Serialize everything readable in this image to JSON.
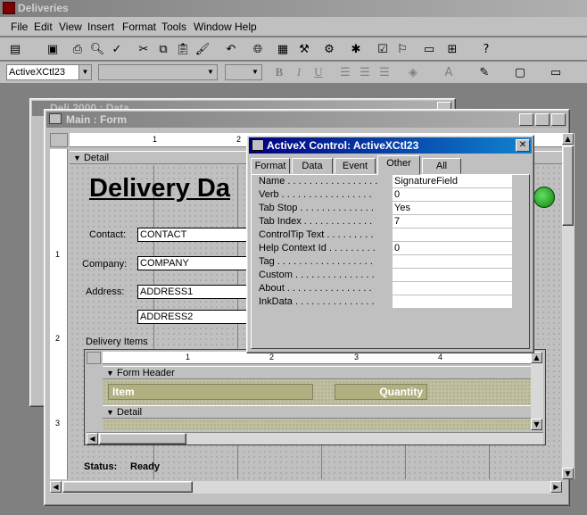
{
  "app": {
    "title": "Deliveries"
  },
  "menu": [
    "File",
    "Edit",
    "View",
    "Insert",
    "Format",
    "Tools",
    "Window",
    "Help"
  ],
  "format_bar": {
    "control_name": "ActiveXCtl23",
    "bold": "B",
    "italic": "I",
    "underline": "U"
  },
  "bg_window": {
    "title": "Deli 2000 : Data"
  },
  "main_form": {
    "title": "Main : Form",
    "detail_label": "Detail",
    "heading": "Delivery Da",
    "fields": [
      {
        "label": "Contact:",
        "value": "CONTACT"
      },
      {
        "label": "Company:",
        "value": "COMPANY"
      },
      {
        "label": "Address:",
        "value": "ADDRESS1"
      },
      {
        "label": "",
        "value": "ADDRESS2"
      }
    ],
    "subform_label": "Delivery Items",
    "subform": {
      "form_header": "Form Header",
      "col_item": "Item",
      "col_quantity": "Quantity",
      "detail": "Detail"
    },
    "status_label": "Status:",
    "status_value": "Ready",
    "ruler_marks": [
      "1",
      "2",
      "3",
      "4"
    ],
    "vruler_marks": [
      "1",
      "2",
      "3"
    ]
  },
  "properties": {
    "title": "ActiveX Control: ActiveXCtl23",
    "tabs": [
      "Format",
      "Data",
      "Event",
      "Other",
      "All"
    ],
    "active_tab": "Other",
    "rows": [
      {
        "name": "Name . . . . . . . . . . . . . . . . .",
        "value": "SignatureField"
      },
      {
        "name": "Verb . . . . . . . . . . . . . . . . .",
        "value": "0"
      },
      {
        "name": "Tab Stop . . . . . . . . . . . . . .",
        "value": "Yes"
      },
      {
        "name": "Tab Index . . . . . . . . . . . . .",
        "value": "7"
      },
      {
        "name": "ControlTip Text . . . . . . . . .",
        "value": ""
      },
      {
        "name": "Help Context Id . . . . . . . . .",
        "value": "0"
      },
      {
        "name": "Tag . . . . . . . . . . . . . . . . . .",
        "value": ""
      },
      {
        "name": "Custom . . . . . . . . . . . . . . .",
        "value": ""
      },
      {
        "name": "About . . . . . . . . . . . . . . . .",
        "value": ""
      },
      {
        "name": "InkData . . . . . . . . . . . . . . .",
        "value": ""
      }
    ]
  },
  "colors": {
    "title_active": "#000080",
    "title_inactive": "#808080",
    "face": "#c0c0c0",
    "field_band": "#b0b070"
  }
}
